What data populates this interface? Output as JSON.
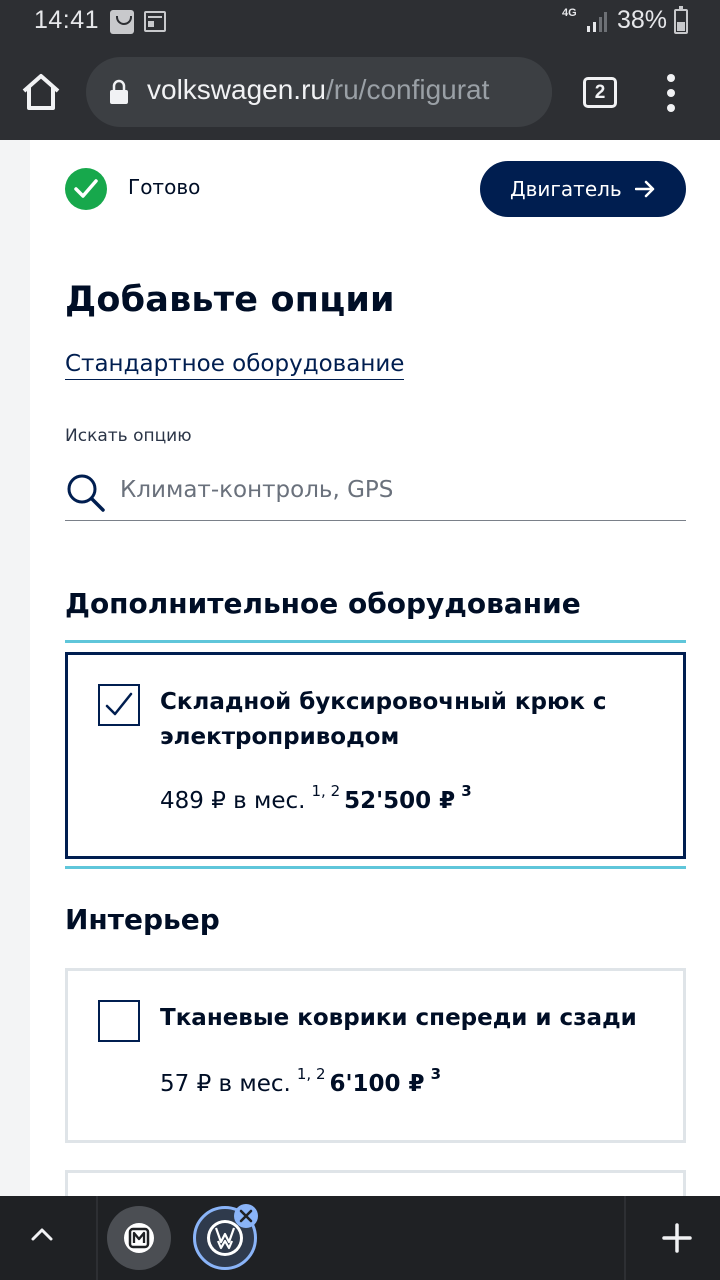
{
  "status_bar": {
    "time": "14:41",
    "network": "4G",
    "battery": "38%"
  },
  "browser": {
    "url_host": "volkswagen.ru",
    "url_path": "/ru/configurat",
    "tabs_count": "2"
  },
  "progress": {
    "done_label": "Готово",
    "next_label": "Двигатель"
  },
  "page": {
    "title": "Добавьте опции",
    "standard_link": "Стандартное оборудование",
    "search_label": "Искать опцию",
    "search_placeholder": "Климат-контроль, GPS",
    "search_value": ""
  },
  "sections": [
    {
      "title": "Дополнительное оборудование",
      "options": [
        {
          "name": "Складной буксировочный крюк с электроприводом",
          "monthly": "489 ₽ в мес.",
          "monthly_notes": "1, 2",
          "total": "52'500 ₽",
          "total_note": "3",
          "checked": true
        }
      ]
    },
    {
      "title": "Интерьер",
      "options": [
        {
          "name": "Тканевые коврики спереди и сзади",
          "monthly": "57 ₽ в мес.",
          "monthly_notes": "1, 2",
          "total": "6'100 ₽",
          "total_note": "3",
          "checked": false
        }
      ]
    }
  ],
  "bottom_bar": {
    "tabs": [
      "tab-m-app",
      "tab-volkswagen"
    ]
  },
  "colors": {
    "brand_dark": "#001e50",
    "accent_rule": "#5fc6da",
    "done_green": "#17a84c",
    "browser_chrome": "#2d2f33"
  }
}
